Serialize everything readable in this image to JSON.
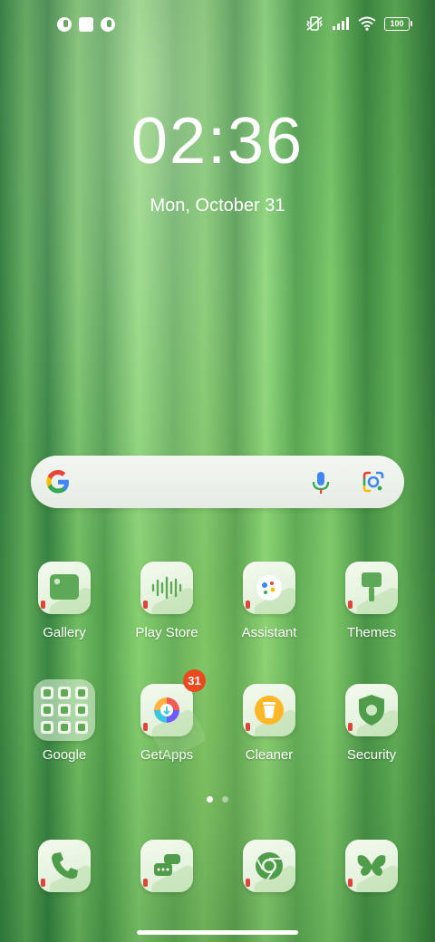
{
  "status_bar": {
    "left_icons": [
      "notification-app-icon",
      "notification-square-icon",
      "notification-app-icon"
    ],
    "right_icons": [
      "vibrate-off-icon",
      "signal-icon",
      "wifi-icon",
      "battery-icon"
    ],
    "battery_level": "100"
  },
  "clock": {
    "time": "02:36",
    "date": "Mon, October 31"
  },
  "search": {
    "icons": [
      "google-logo",
      "mic-icon",
      "lens-icon"
    ]
  },
  "apps_row1": [
    {
      "label": "Gallery",
      "icon": "gallery-icon"
    },
    {
      "label": "Play Store",
      "icon": "play-store-icon"
    },
    {
      "label": "Assistant",
      "icon": "assistant-icon"
    },
    {
      "label": "Themes",
      "icon": "themes-icon"
    }
  ],
  "apps_row2": [
    {
      "label": "Google",
      "icon": "google-folder-icon"
    },
    {
      "label": "GetApps",
      "icon": "getapps-icon",
      "badge": "31"
    },
    {
      "label": "Cleaner",
      "icon": "cleaner-icon"
    },
    {
      "label": "Security",
      "icon": "security-icon"
    }
  ],
  "dock": [
    {
      "icon": "phone-icon"
    },
    {
      "icon": "messages-icon"
    },
    {
      "icon": "chrome-icon"
    },
    {
      "icon": "butterfly-icon"
    }
  ],
  "pager": {
    "pages": 2,
    "active": 1
  },
  "colors": {
    "accent": "#5fa858",
    "badge": "#e94a1f",
    "wallpaper": "#5aa657"
  }
}
